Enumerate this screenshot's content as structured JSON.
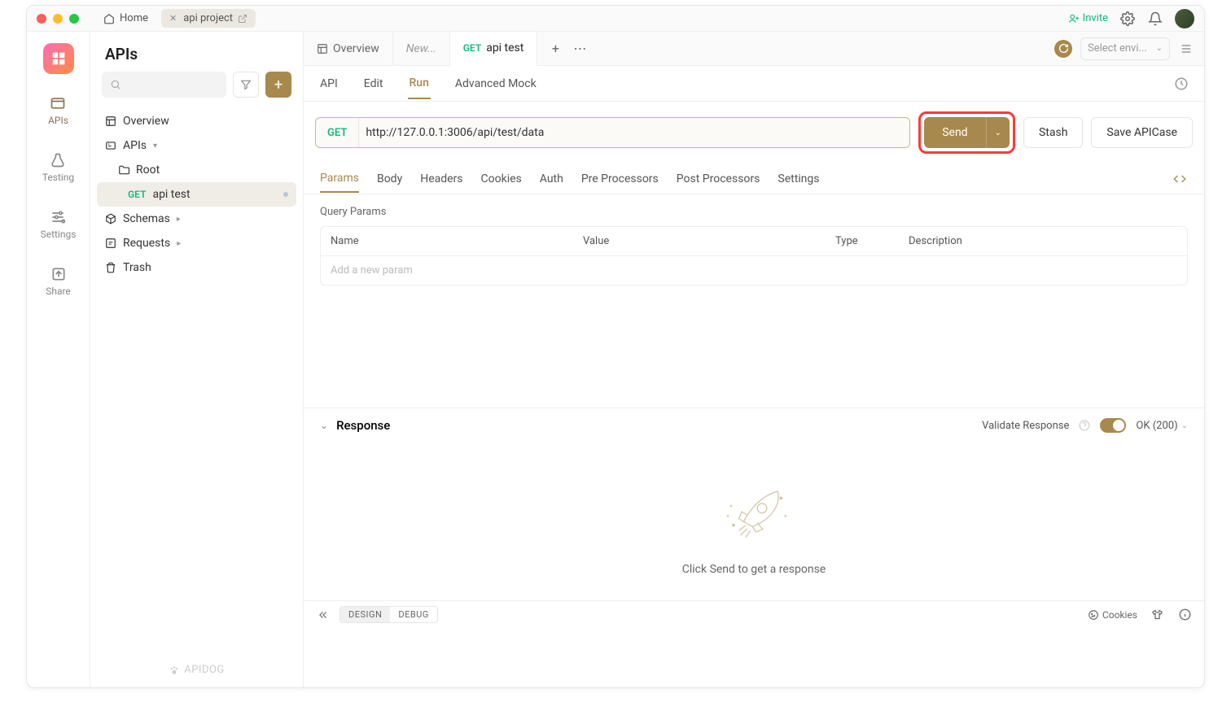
{
  "titlebar": {
    "home": "Home",
    "project": "api project",
    "invite": "Invite"
  },
  "rail": {
    "apis": "APIs",
    "testing": "Testing",
    "settings": "Settings",
    "share": "Share"
  },
  "sidebar": {
    "title": "APIs",
    "tree": {
      "overview": "Overview",
      "apis": "APIs",
      "root": "Root",
      "apitest_method": "GET",
      "apitest": "api test",
      "schemas": "Schemas",
      "requests": "Requests",
      "trash": "Trash"
    },
    "footer": "APIDOG"
  },
  "tabs": {
    "overview": "Overview",
    "new": "New...",
    "apitest_method": "GET",
    "apitest": "api test",
    "env_placeholder": "Select envi..."
  },
  "subtabs": {
    "api": "API",
    "edit": "Edit",
    "run": "Run",
    "mock": "Advanced Mock"
  },
  "request": {
    "method": "GET",
    "url": "http://127.0.0.1:3006/api/test/data",
    "send": "Send",
    "stash": "Stash",
    "save": "Save APICase"
  },
  "paramtabs": {
    "params": "Params",
    "body": "Body",
    "headers": "Headers",
    "cookies": "Cookies",
    "auth": "Auth",
    "pre": "Pre Processors",
    "post": "Post Processors",
    "settings": "Settings"
  },
  "query": {
    "section": "Query Params",
    "cols": {
      "name": "Name",
      "value": "Value",
      "type": "Type",
      "desc": "Description"
    },
    "placeholder": "Add a new param"
  },
  "response": {
    "title": "Response",
    "validate": "Validate Response",
    "status": "OK (200)",
    "empty": "Click Send to get a response"
  },
  "bottombar": {
    "design": "DESIGN",
    "debug": "DEBUG",
    "cookies": "Cookies"
  }
}
